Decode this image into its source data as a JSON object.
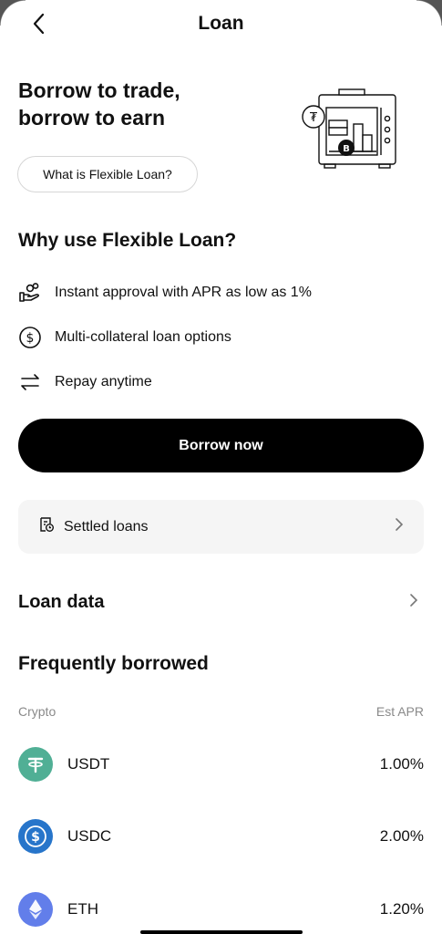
{
  "header": {
    "title": "Loan"
  },
  "hero": {
    "line1": "Borrow to trade,",
    "line2": "borrow to earn",
    "what_button": "What is Flexible Loan?"
  },
  "why": {
    "title": "Why use Flexible Loan?",
    "features": [
      {
        "icon": "hand-coins-icon",
        "label": "Instant approval with APR as low as 1%"
      },
      {
        "icon": "dollar-circle-icon",
        "label": "Multi-collateral loan options"
      },
      {
        "icon": "swap-arrows-icon",
        "label": "Repay anytime"
      }
    ]
  },
  "actions": {
    "borrow_now": "Borrow now",
    "settled_loans": "Settled loans",
    "loan_data": "Loan data"
  },
  "frequent": {
    "title": "Frequently borrowed",
    "col_crypto": "Crypto",
    "col_apr": "Est APR",
    "rows": [
      {
        "symbol": "USDT",
        "apr": "1.00%",
        "color": "#50AF95"
      },
      {
        "symbol": "USDC",
        "apr": "2.00%",
        "color": "#2775CA"
      },
      {
        "symbol": "ETH",
        "apr": "1.20%",
        "color": "#627EEA"
      }
    ]
  },
  "colors": {
    "primary": "#000000",
    "muted": "#8a8a8a",
    "card_bg": "#f5f5f5"
  }
}
